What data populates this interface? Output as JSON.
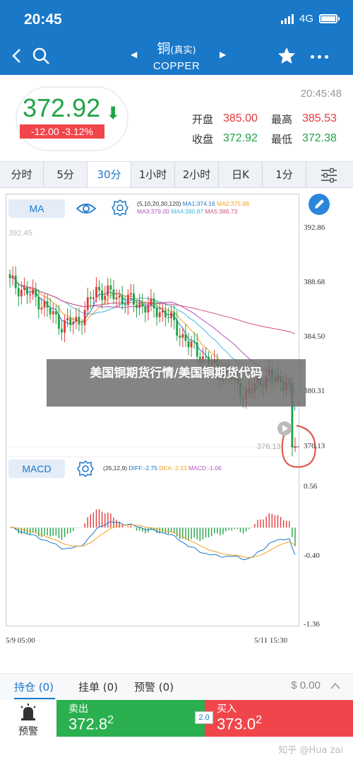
{
  "status": {
    "time": "20:45",
    "network": "4G"
  },
  "nav": {
    "title_cn": "铜",
    "title_cn_suffix": "(真实)",
    "title_en": "COPPER"
  },
  "quote": {
    "price": "372.92",
    "arrow": "⬇",
    "change": "-12.00  -3.12%",
    "time": "20:45:48",
    "open_label": "开盘",
    "open": "385.00",
    "high_label": "最高",
    "high": "385.53",
    "close_label": "收盘",
    "close": "372.92",
    "low_label": "最低",
    "low": "372.38"
  },
  "periods": [
    "分时",
    "5分",
    "30分",
    "1小时",
    "2小时",
    "日K",
    "1分"
  ],
  "active_period": "30分",
  "chart": {
    "ma_button": "MA",
    "ma_params": "(5,10,20,30,120)",
    "ma1": "MA1:374.16",
    "ma2": "MA2:375.98",
    "ma3": "MA3:379.00",
    "ma4": "MA4:380.87",
    "ma5": "MA5:386.73",
    "macd_button": "MACD",
    "macd_params": "(26,12,9)",
    "diff": "DIFF:-2.75",
    "dea": "DEA:-2.23",
    "macd": "MACD:-1.06",
    "y_labels": [
      "392.86",
      "388.68",
      "384.50",
      "380.31",
      "376.13"
    ],
    "macd_labels": [
      "0.56",
      "-0.40",
      "-1.36"
    ],
    "ref_price": "392.45",
    "last_price": "376.13",
    "date_start": "5/9 05:00",
    "date_end": "5/11 15:30",
    "colors": {
      "up": "#e4393c",
      "down": "#21a346",
      "ma1": "#1a78c9",
      "ma2": "#f0a020",
      "ma3": "#b050c0",
      "ma4": "#40b8d8",
      "ma5": "#d05080"
    }
  },
  "overlay": {
    "text": "美国铜期货行情/美国铜期货代码"
  },
  "bottom_tabs": {
    "positions": "持仓 (0)",
    "orders": "挂单 (0)",
    "alerts": "预警 (0)",
    "amount": "$ 0.00"
  },
  "trade": {
    "alert_label": "预警",
    "sell_label": "卖出",
    "sell_price_a": "372.8",
    "sell_price_b": "2",
    "buy_label": "买入",
    "buy_price_a": "373.0",
    "buy_price_b": "2",
    "spread": "2.0"
  },
  "watermark": "知乎 @Hua zai"
}
